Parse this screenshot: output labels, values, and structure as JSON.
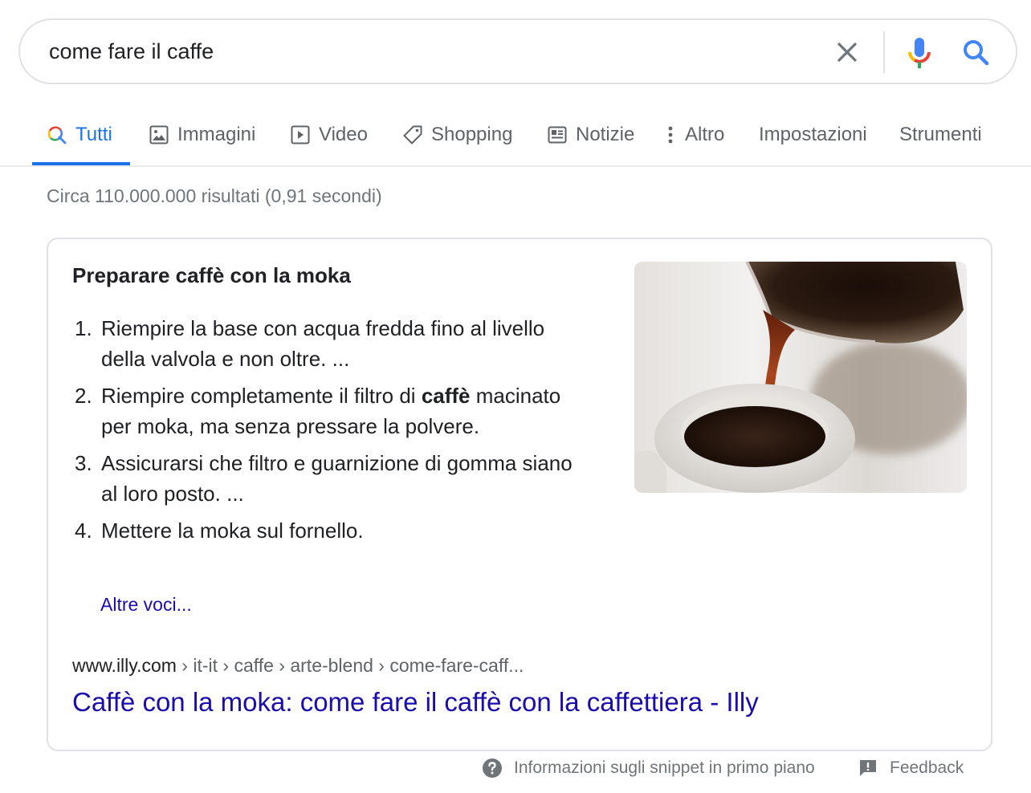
{
  "search": {
    "query": "come fare il caffe",
    "clear_icon": "close-icon",
    "mic_icon": "microphone-icon",
    "search_icon": "search-icon"
  },
  "tabs": [
    {
      "label": "Tutti",
      "icon": "search-icon",
      "active": true
    },
    {
      "label": "Immagini",
      "icon": "image-icon",
      "active": false
    },
    {
      "label": "Video",
      "icon": "play-icon",
      "active": false
    },
    {
      "label": "Shopping",
      "icon": "tag-icon",
      "active": false
    },
    {
      "label": "Notizie",
      "icon": "news-icon",
      "active": false
    },
    {
      "label": "Altro",
      "icon": "more-vert-icon",
      "active": false
    },
    {
      "label": "Impostazioni",
      "active": false
    },
    {
      "label": "Strumenti",
      "active": false
    }
  ],
  "results_stats": "Circa 110.000.000 risultati (0,91 secondi)",
  "featured_snippet": {
    "title": "Preparare caffè con la moka",
    "steps": [
      {
        "num": "1.",
        "text_before": "Riempire la base con acqua fredda fino al livello della valvola e non oltre. ...",
        "bold": "",
        "text_after": ""
      },
      {
        "num": "2.",
        "text_before": "Riempire completamente il filtro di ",
        "bold": "caffè",
        "text_after": " macinato per moka, ma senza pressare la polvere."
      },
      {
        "num": "3.",
        "text_before": "Assicurarsi che filtro e guarnizione di gomma siano al loro posto. ...",
        "bold": "",
        "text_after": ""
      },
      {
        "num": "4.",
        "text_before": "Mettere la moka sul fornello.",
        "bold": "",
        "text_after": ""
      }
    ],
    "more_link": "Altre voci...",
    "image_alt": "coffee pouring into cup",
    "breadcrumb": {
      "domain": "www.illy.com",
      "path": " › it-it › caffe › arte-blend › come-fare-caff..."
    },
    "result_title": "Caffè con la moka: come fare il caffè con la caffettiera - Illy"
  },
  "footer": {
    "info_label": "Informazioni sugli snippet in primo piano",
    "feedback_label": "Feedback"
  },
  "colors": {
    "accent": "#1a73e8",
    "link": "#1a0dab",
    "muted": "#70757a"
  }
}
